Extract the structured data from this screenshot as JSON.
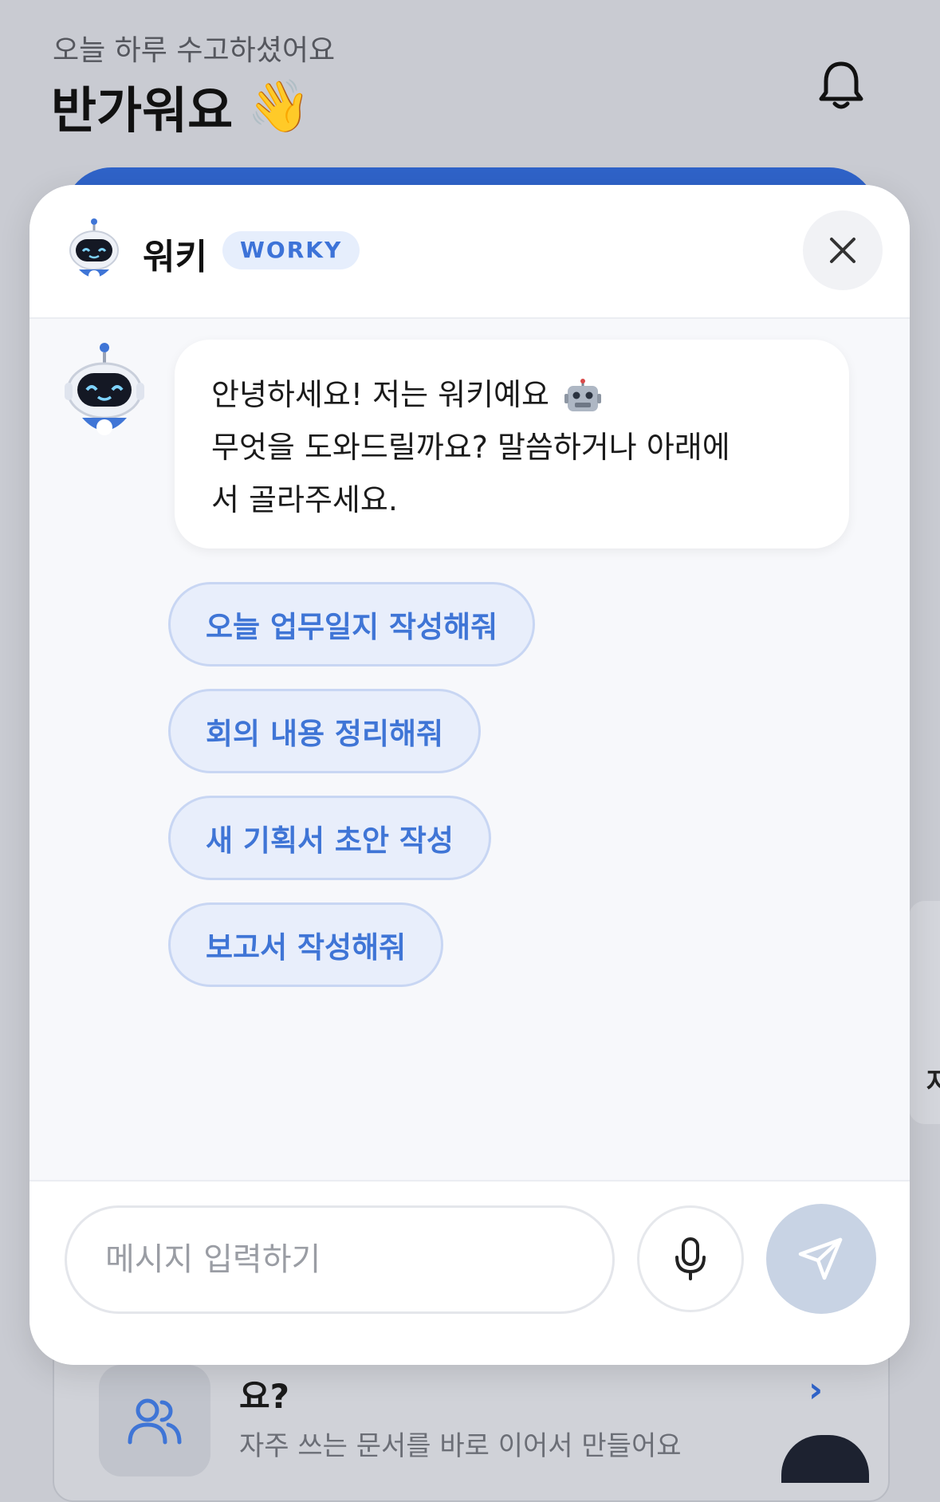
{
  "home": {
    "greeting": "오늘 하루 수고하셨어요",
    "title": "반가워요",
    "wave_emoji": "👋",
    "card_question": "요?",
    "card_subtitle": "자주 쓰는 문서를 바로 이어서 만들어요",
    "right_card_fragment": "자"
  },
  "chat": {
    "header": {
      "name": "워키",
      "badge": "WORKY"
    },
    "message": {
      "lines": [
        "안녕하세요! 저는 워키예요",
        "무엇을 도와드릴까요? 말씀하거나 아래에",
        "서 골라주세요."
      ],
      "trailing_icon": "robot-face-icon"
    },
    "suggestions": [
      "오늘 업무일지 작성해줘",
      "회의 내용 정리해줘",
      "새 기획서 초안 작성",
      "보고서 작성해줘"
    ],
    "input": {
      "placeholder": "메시지 입력하기",
      "value": ""
    }
  },
  "colors": {
    "accent": "#3f75d6",
    "chip_bg": "#e8eefb",
    "send_disabled": "#c8d3e4",
    "banner": "#2f63c9"
  }
}
